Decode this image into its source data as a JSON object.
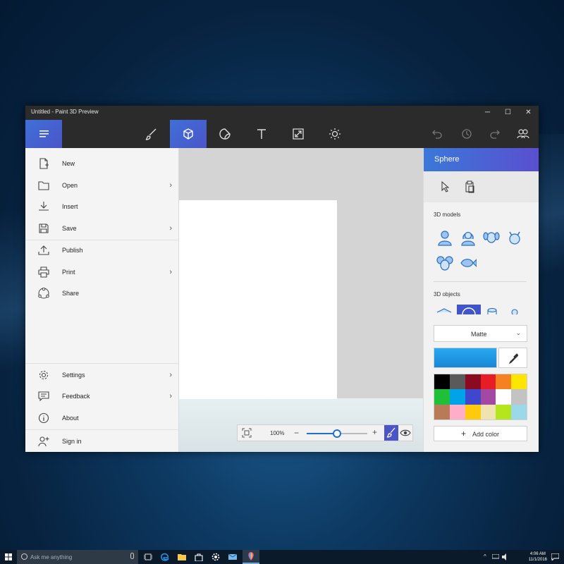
{
  "window": {
    "title": "Untitled - Paint 3D Preview",
    "controls": [
      "─",
      "☐",
      "✕"
    ]
  },
  "toolbar": {
    "tools": [
      {
        "name": "brushes-tool",
        "icon": "brush-icon"
      },
      {
        "name": "3d-objects-tool",
        "icon": "cube-icon",
        "active": true
      },
      {
        "name": "stickers-tool",
        "icon": "sticker-icon"
      },
      {
        "name": "text-tool",
        "icon": "text-icon"
      },
      {
        "name": "canvas-tool",
        "icon": "resize-icon"
      },
      {
        "name": "effects-tool",
        "icon": "sun-icon"
      }
    ],
    "right": [
      "undo-icon",
      "history-icon",
      "redo-icon",
      "community-icon"
    ]
  },
  "menu": {
    "items": [
      {
        "label": "New",
        "icon": "new-file-icon",
        "chevron": false
      },
      {
        "label": "Open",
        "icon": "folder-icon",
        "chevron": true
      },
      {
        "label": "Insert",
        "icon": "insert-icon",
        "chevron": false
      },
      {
        "label": "Save",
        "icon": "save-icon",
        "chevron": true
      },
      {
        "label": "Publish",
        "icon": "upload-icon",
        "chevron": false
      },
      {
        "label": "Print",
        "icon": "printer-icon",
        "chevron": true
      },
      {
        "label": "Share",
        "icon": "share-icon",
        "chevron": false
      }
    ],
    "bottom_items": [
      {
        "label": "Settings",
        "icon": "gear-icon",
        "chevron": true
      },
      {
        "label": "Feedback",
        "icon": "feedback-icon",
        "chevron": true
      },
      {
        "label": "About",
        "icon": "info-icon",
        "chevron": false
      },
      {
        "label": "Sign in",
        "icon": "add-person-icon",
        "chevron": false
      }
    ]
  },
  "zoom": {
    "value": "100%",
    "level": 0.5
  },
  "panel": {
    "title": "Sphere",
    "models_title": "3D models",
    "models": [
      "man-model-icon",
      "woman-model-icon",
      "dog-model-icon",
      "cat-model-icon",
      "mouse-model-icon",
      "fish-model-icon"
    ],
    "objects_title": "3D objects",
    "finish": "Matte",
    "current_color": "#1f96e6",
    "swatches": [
      "#000000",
      "#5a5a5a",
      "#8b0a1f",
      "#e81c24",
      "#f58220",
      "#ffe600",
      "#1fbf3a",
      "#00a2e8",
      "#3f48cc",
      "#a349a4",
      "#ffffff",
      "#c3c3c3",
      "#b97a57",
      "#ffaec9",
      "#ffc90e",
      "#efe4b0",
      "#b5e61d",
      "#99d9ea"
    ],
    "add_color": "Add color"
  },
  "taskbar": {
    "search_placeholder": "Ask me anything",
    "time": "4:06 AM",
    "date": "11/1/2016"
  }
}
